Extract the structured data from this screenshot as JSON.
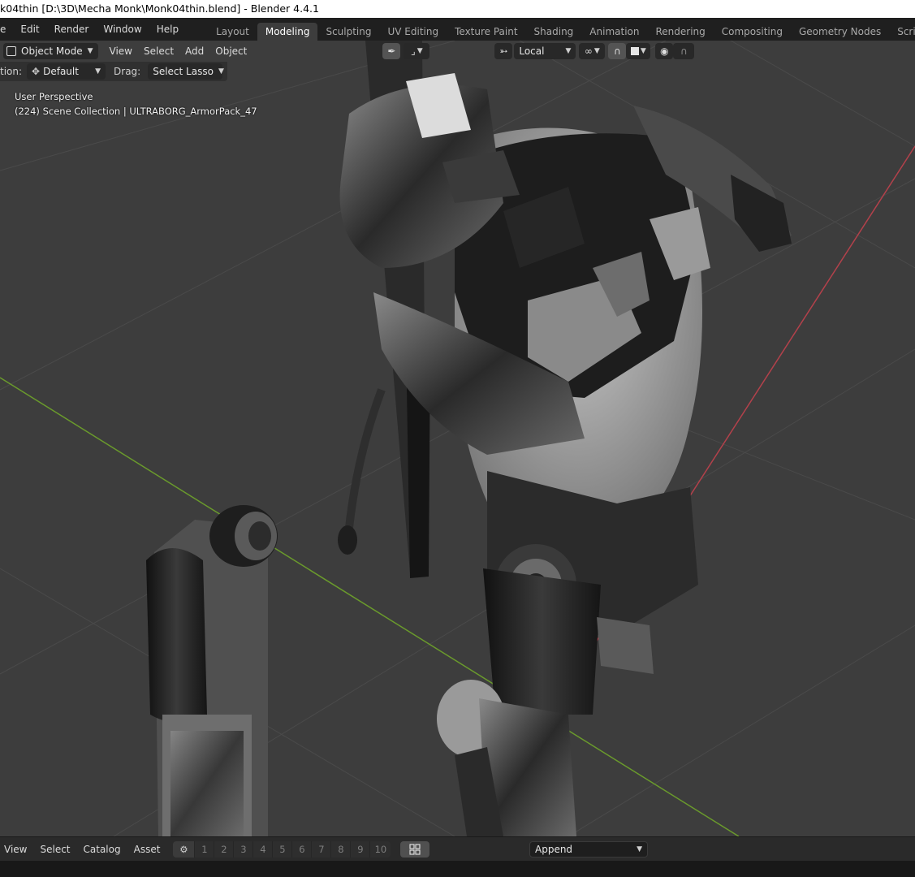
{
  "window": {
    "title": "k04thin [D:\\3D\\Mecha Monk\\Monk04thin.blend] - Blender 4.4.1"
  },
  "menu": [
    "e",
    "Edit",
    "Render",
    "Window",
    "Help"
  ],
  "workspaces": [
    {
      "label": "Layout",
      "active": false
    },
    {
      "label": "Modeling",
      "active": true
    },
    {
      "label": "Sculpting",
      "active": false
    },
    {
      "label": "UV Editing",
      "active": false
    },
    {
      "label": "Texture Paint",
      "active": false
    },
    {
      "label": "Shading",
      "active": false
    },
    {
      "label": "Animation",
      "active": false
    },
    {
      "label": "Rendering",
      "active": false
    },
    {
      "label": "Compositing",
      "active": false
    },
    {
      "label": "Geometry Nodes",
      "active": false
    },
    {
      "label": "Scripting",
      "active": false
    }
  ],
  "header": {
    "mode": "Object Mode",
    "menus": [
      "View",
      "Select",
      "Add",
      "Object"
    ],
    "transform_space": "Local"
  },
  "tool_options": {
    "orientation_label": "tion:",
    "orientation_value": "Default",
    "drag_label": "Drag:",
    "drag_value": "Select Lasso"
  },
  "viewport": {
    "perspective": "User Perspective",
    "collection_info": "(224) Scene Collection | ULTRABORG_ArmorPack_47"
  },
  "asset_bar": {
    "menus": [
      "View",
      "Select",
      "Catalog",
      "Asset"
    ],
    "numbers": [
      "1",
      "2",
      "3",
      "4",
      "5",
      "6",
      "7",
      "8",
      "9",
      "10"
    ],
    "import_method": "Append"
  },
  "colors": {
    "viewport_bg": "#3d3d3d",
    "x_axis": "#b3414b",
    "y_axis": "#6a9a2c",
    "accent": "#4772b3"
  }
}
